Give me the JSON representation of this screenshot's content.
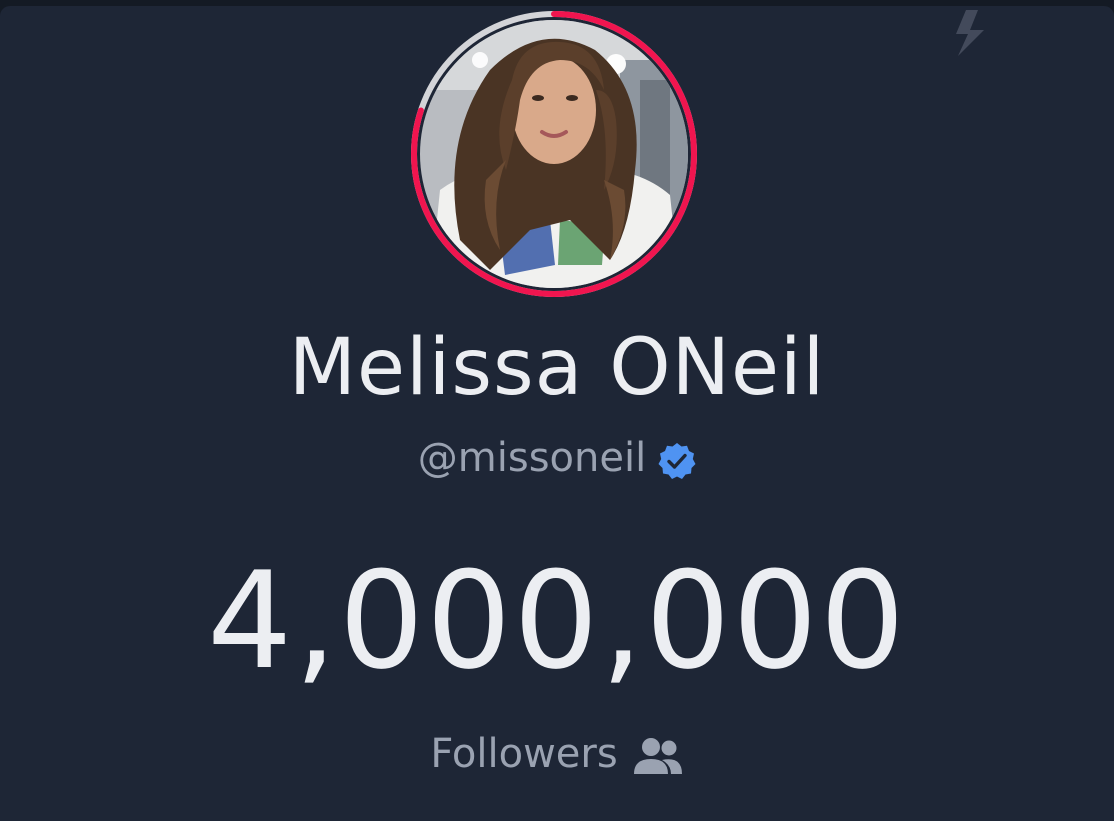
{
  "profile": {
    "display_name": "Melissa ONeil",
    "handle": "@missoneil",
    "verified": true,
    "avatar_description": "profile photo"
  },
  "stats": {
    "followers_count": "4,000,000",
    "followers_label": "Followers"
  },
  "icons": {
    "corner": "lightning-bolt-icon",
    "verified": "verified-badge-icon",
    "followers": "users-icon"
  },
  "colors": {
    "background": "#1e2636",
    "ring_progress": "#f0154f",
    "ring_track": "#d3d4d8",
    "verified_badge": "#4f93f2",
    "primary_text": "#eceef2",
    "secondary_text": "#9aa2b1"
  },
  "progress_ring": {
    "fraction": 0.8
  }
}
